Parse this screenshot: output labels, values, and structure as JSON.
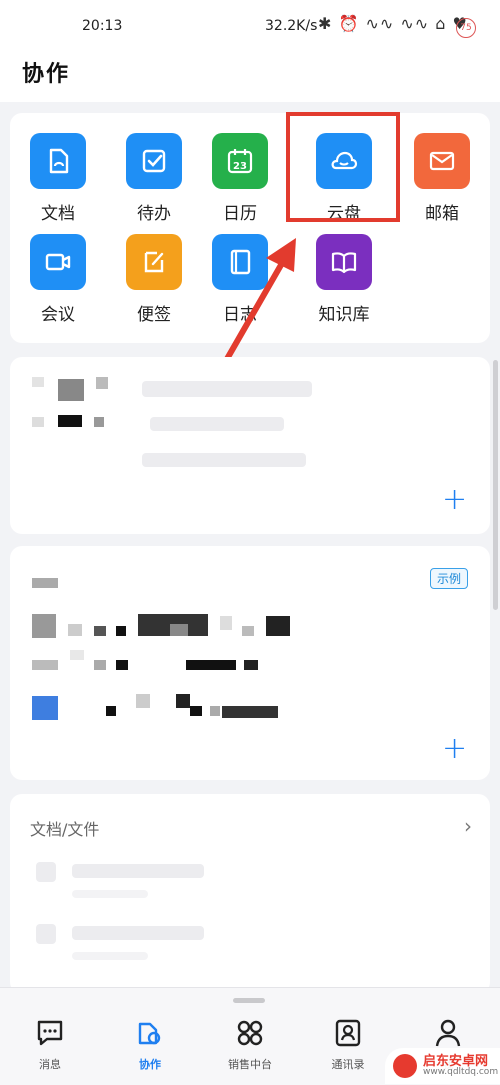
{
  "status_bar": {
    "time": "20:13",
    "net_speed": "32.2K/s",
    "icons_text": "✱ ⏰ ∿∿ ∿∿ ⌂ ♥",
    "battery": "75"
  },
  "header": {
    "title": "协作"
  },
  "apps": [
    {
      "label": "文档",
      "icon": "document-icon",
      "color": "#1f8ff5"
    },
    {
      "label": "待办",
      "icon": "checkbox-icon",
      "color": "#1f8ff5"
    },
    {
      "label": "日历",
      "icon": "calendar-icon",
      "color": "#25b04b",
      "day": "23"
    },
    {
      "label": "云盘",
      "icon": "cloud-icon",
      "color": "#1f8ff5"
    },
    {
      "label": "邮箱",
      "icon": "mail-icon",
      "color": "#f2683c"
    },
    {
      "label": "会议",
      "icon": "video-icon",
      "color": "#1f8ff5"
    },
    {
      "label": "便签",
      "icon": "note-icon",
      "color": "#f4a01c"
    },
    {
      "label": "日志",
      "icon": "log-icon",
      "color": "#1f8ff5"
    },
    {
      "label": "知识库",
      "icon": "book-icon",
      "color": "#7b2fbf"
    }
  ],
  "card2": {
    "badge": "示例"
  },
  "files": {
    "title": "文档/文件"
  },
  "nav": [
    {
      "label": "消息",
      "icon": "message-icon",
      "active": false
    },
    {
      "label": "协作",
      "icon": "collab-icon",
      "active": true
    },
    {
      "label": "销售中台",
      "icon": "grid-icon",
      "active": false
    },
    {
      "label": "通讯录",
      "icon": "contacts-icon",
      "active": false
    },
    {
      "label": "我",
      "icon": "user-icon",
      "active": false
    }
  ],
  "watermark": {
    "name": "启东安卓网",
    "url": "www.qdltdq.com"
  },
  "colors": {
    "accent": "#1f7ff0",
    "annotation": "#e23b2e"
  }
}
